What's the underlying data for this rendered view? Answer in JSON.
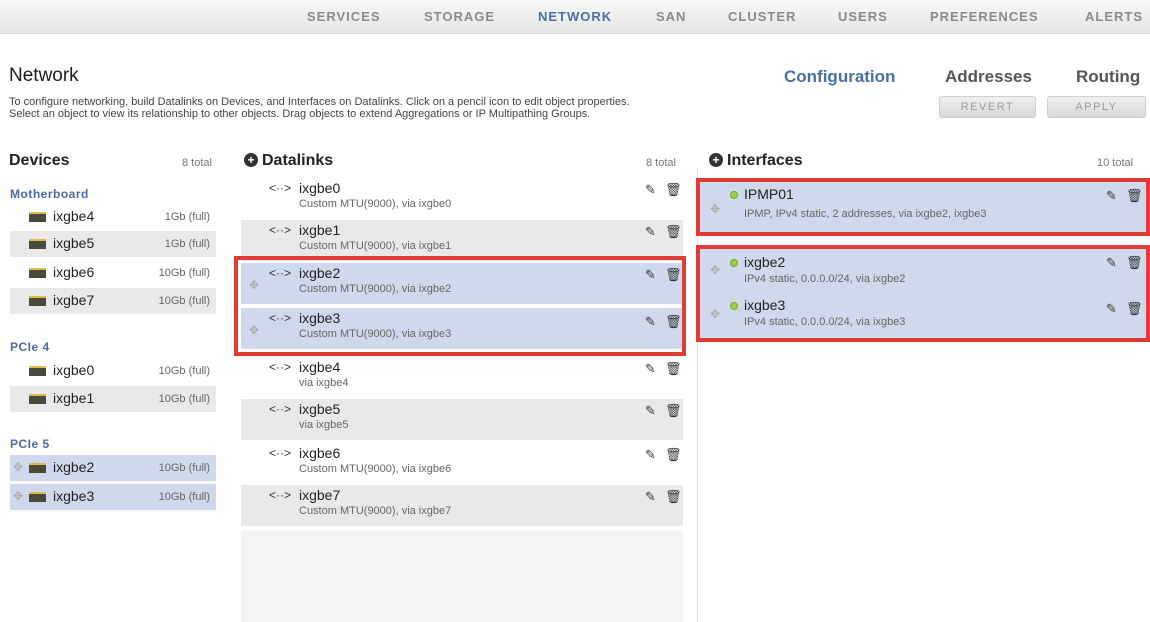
{
  "nav": {
    "items": [
      {
        "label": "SERVICES"
      },
      {
        "label": "STORAGE"
      },
      {
        "label": "NETWORK"
      },
      {
        "label": "SAN"
      },
      {
        "label": "CLUSTER"
      },
      {
        "label": "USERS"
      },
      {
        "label": "PREFERENCES"
      },
      {
        "label": "ALERTS"
      }
    ],
    "active": "NETWORK"
  },
  "page": {
    "title": "Network",
    "tabs": [
      {
        "label": "Configuration"
      },
      {
        "label": "Addresses"
      },
      {
        "label": "Routing"
      }
    ],
    "active_tab": "Configuration",
    "intro_line1": "To configure networking, build Datalinks on Devices, and Interfaces on Datalinks. Click on a pencil icon to edit object properties.",
    "intro_line2": "Select an object to view its relationship to other objects. Drag objects to extend Aggregations or IP Multipathing Groups.",
    "revert_label": "REVERT",
    "apply_label": "APPLY"
  },
  "devices": {
    "title": "Devices",
    "total": "8 total",
    "sections": [
      {
        "label": "Motherboard",
        "items": [
          {
            "name": "ixgbe4",
            "speed": "1Gb (full)"
          },
          {
            "name": "ixgbe5",
            "speed": "1Gb (full)"
          },
          {
            "name": "ixgbe6",
            "speed": "10Gb (full)"
          },
          {
            "name": "ixgbe7",
            "speed": "10Gb (full)"
          }
        ]
      },
      {
        "label": "PCIe 4",
        "items": [
          {
            "name": "ixgbe0",
            "speed": "10Gb (full)"
          },
          {
            "name": "ixgbe1",
            "speed": "10Gb (full)"
          }
        ]
      },
      {
        "label": "PCIe 5",
        "items": [
          {
            "name": "ixgbe2",
            "speed": "10Gb (full)"
          },
          {
            "name": "ixgbe3",
            "speed": "10Gb (full)"
          }
        ]
      }
    ]
  },
  "datalinks": {
    "title": "Datalinks",
    "total": "8 total",
    "arrow_glyph": "<··>",
    "items": [
      {
        "name": "ixgbe0",
        "desc": "Custom MTU(9000), via ixgbe0"
      },
      {
        "name": "ixgbe1",
        "desc": "Custom MTU(9000), via ixgbe1"
      },
      {
        "name": "ixgbe2",
        "desc": "Custom MTU(9000), via ixgbe2"
      },
      {
        "name": "ixgbe3",
        "desc": "Custom MTU(9000), via ixgbe3"
      },
      {
        "name": "ixgbe4",
        "desc": "via ixgbe4"
      },
      {
        "name": "ixgbe5",
        "desc": "via ixgbe5"
      },
      {
        "name": "ixgbe6",
        "desc": "Custom MTU(9000), via ixgbe6"
      },
      {
        "name": "ixgbe7",
        "desc": "Custom MTU(9000), via ixgbe7"
      }
    ]
  },
  "interfaces": {
    "title": "Interfaces",
    "total": "10 total",
    "items": [
      {
        "name": "IPMP01",
        "desc": "IPMP, IPv4 static, 2 addresses, via ixgbe2, ixgbe3"
      },
      {
        "name": "ixgbe2",
        "desc": "IPv4 static, 0.0.0.0/24, via ixgbe2"
      },
      {
        "name": "ixgbe3",
        "desc": "IPv4 static, 0.0.0.0/24, via ixgbe3"
      }
    ]
  },
  "colors": {
    "accent": "#4a6fa6",
    "selected_row": "#cfd8ec",
    "highlight_box": "#e23b34",
    "status_up": "#9ad13f"
  },
  "icons": {
    "edit": "pencil-icon",
    "delete": "trash-icon",
    "add": "plus-circle-icon",
    "drag": "drag-handle-icon",
    "link": "datalink-arrows-icon",
    "device": "nic-chip-icon",
    "status": "status-dot-icon"
  }
}
